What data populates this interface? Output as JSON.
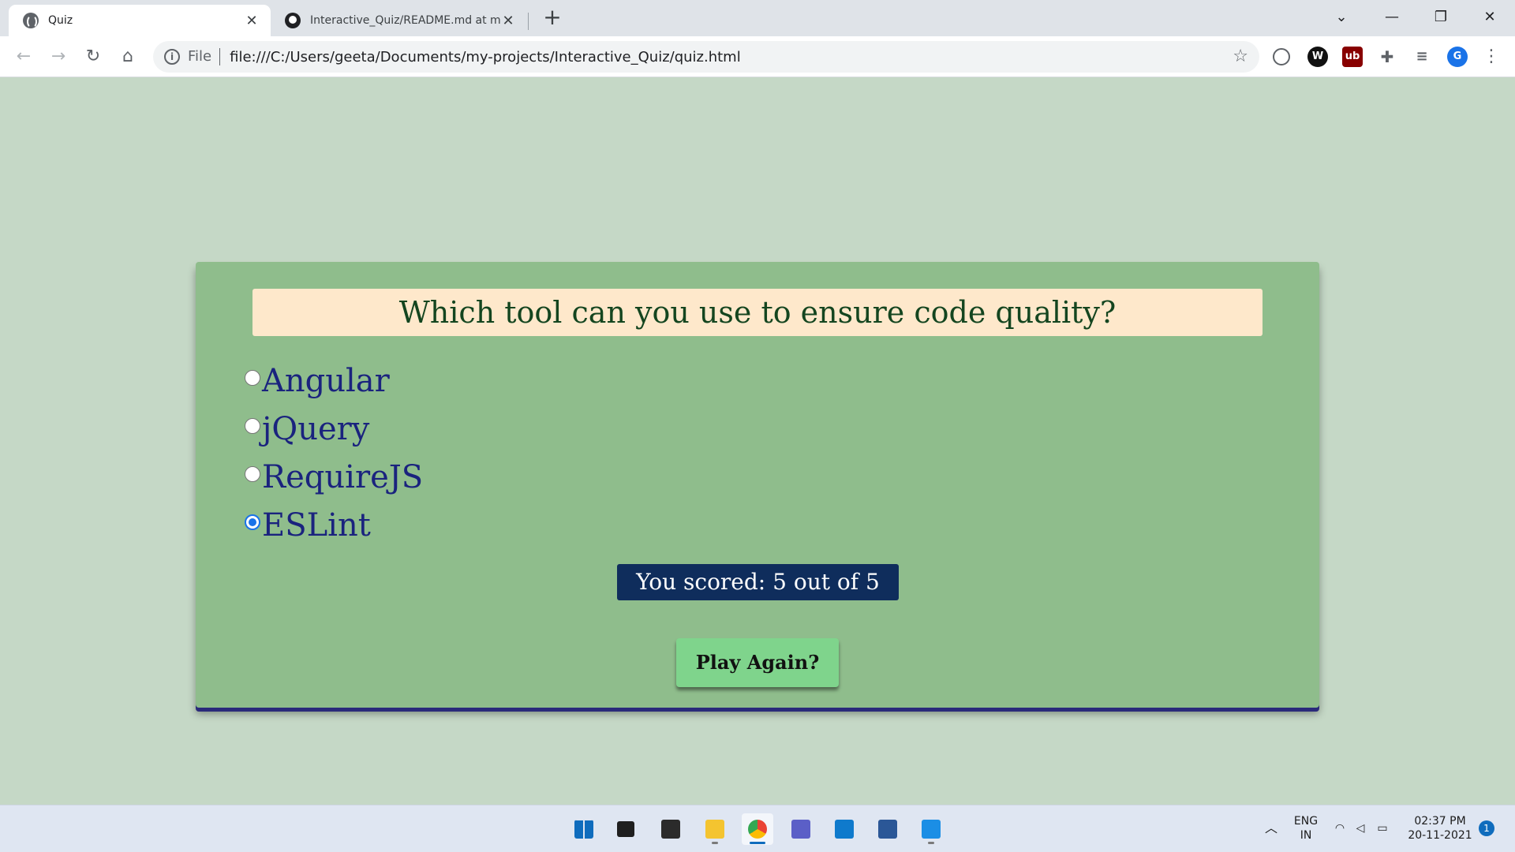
{
  "browser": {
    "tabs": [
      {
        "title": "Quiz",
        "active": true
      },
      {
        "title": "Interactive_Quiz/README.md at mai",
        "active": false
      }
    ],
    "new_tab_label": "+",
    "window_controls": {
      "dropdown": "⌄",
      "minimize": "—",
      "restore": "❐",
      "close": "✕"
    },
    "address": {
      "scheme_label": "File",
      "url": "file:///C:/Users/geeta/Documents/my-projects/Interactive_Quiz/quiz.html"
    },
    "nav": {
      "back": "←",
      "forward": "→",
      "reload": "↻",
      "home": "⌂",
      "menu": "⋮"
    },
    "profile_initial": "G"
  },
  "quiz": {
    "question": "Which tool can you use to ensure code quality?",
    "options": [
      {
        "label": "Angular",
        "checked": false
      },
      {
        "label": "jQuery",
        "checked": false
      },
      {
        "label": "RequireJS",
        "checked": false
      },
      {
        "label": "ESLint",
        "checked": true
      }
    ],
    "score_text": "You scored: 5 out of 5",
    "play_again_label": "Play Again?"
  },
  "taskbar": {
    "apps": [
      "start-icon",
      "task-view-icon",
      "terminal-icon",
      "file-explorer-icon",
      "chrome-icon",
      "teams-icon",
      "vscode-icon",
      "store-icon",
      "photos-icon"
    ],
    "language": {
      "line1": "ENG",
      "line2": "IN"
    },
    "clock": {
      "time": "02:37 PM",
      "date": "20-11-2021"
    },
    "notification_count": "1"
  },
  "colors": {
    "page_bg": "#c5d8c6",
    "card_bg": "#8fbd8c",
    "question_bg": "#fee8cb",
    "option_text": "#1a237e",
    "score_bg": "#0f2d5c",
    "button_bg": "#7fd48c"
  }
}
